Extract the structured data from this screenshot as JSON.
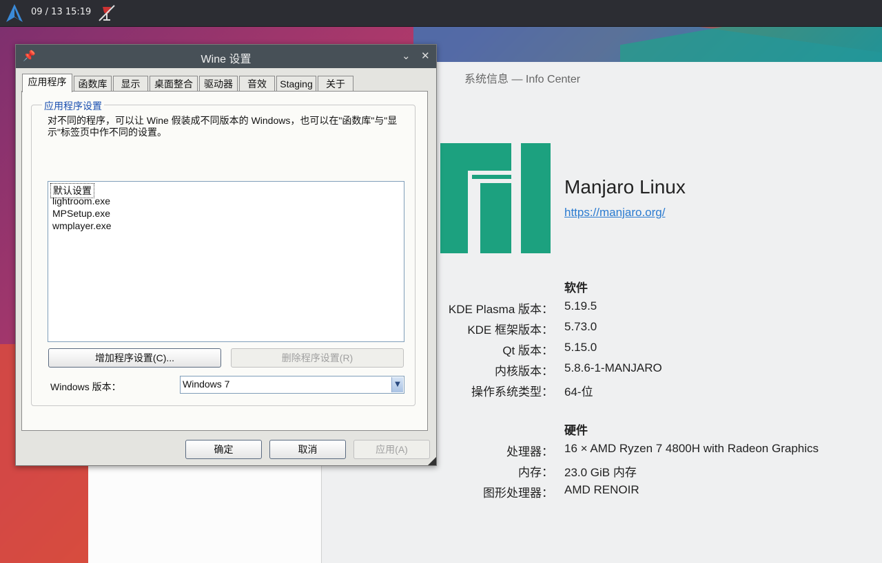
{
  "topbar": {
    "clock": "09 / 13 15:19",
    "launcher_icon": "manjaro-launcher-icon",
    "tray_icon": "wine-icon"
  },
  "wine_window": {
    "title": "Wine 设置",
    "pin_icon": "pin-icon",
    "minimize_icon": "chevron-down-icon",
    "close_icon": "close-icon",
    "tabs": [
      "应用程序",
      "函数库",
      "显示",
      "桌面整合",
      "驱动器",
      "音效",
      "Staging",
      "关于"
    ],
    "active_tab": "应用程序",
    "group_label": "应用程序设置",
    "description": "对不同的程序，可以让 Wine 假装成不同版本的 Windows，也可以在\"函数库\"与\"显示\"标签页中作不同的设置。",
    "apps": [
      "默认设置",
      "lightroom.exe",
      "MPSetup.exe",
      "wmplayer.exe"
    ],
    "add_button": "增加程序设置(C)...",
    "remove_button": "删除程序设置(R)",
    "winver_label": "Windows 版本：",
    "winver_value": "Windows 7",
    "ok_button": "确定",
    "cancel_button": "取消",
    "apply_button": "应用(A)"
  },
  "info_center": {
    "title": "系统信息 — Info Center",
    "distro_name": "Manjaro Linux",
    "distro_url": "https://manjaro.org/",
    "software_heading": "软件",
    "software": [
      {
        "key": "KDE Plasma 版本：",
        "value": "5.19.5"
      },
      {
        "key": "KDE 框架版本：",
        "value": "5.73.0"
      },
      {
        "key": "Qt 版本：",
        "value": "5.15.0"
      },
      {
        "key": "内核版本：",
        "value": "5.8.6-1-MANJARO"
      },
      {
        "key": "操作系统类型：",
        "value": "64-位"
      }
    ],
    "hardware_heading": "硬件",
    "hardware": [
      {
        "key": "处理器：",
        "value": "16 × AMD Ryzen 7 4800H with Radeon Graphics"
      },
      {
        "key": "内存：",
        "value": "23.0 GiB 内存"
      },
      {
        "key": "图形处理器：",
        "value": "AMD RENOIR"
      }
    ]
  },
  "colors": {
    "manjaro_green": "#1ca17f",
    "link_blue": "#2b7bd0",
    "titlebar": "#475057"
  }
}
